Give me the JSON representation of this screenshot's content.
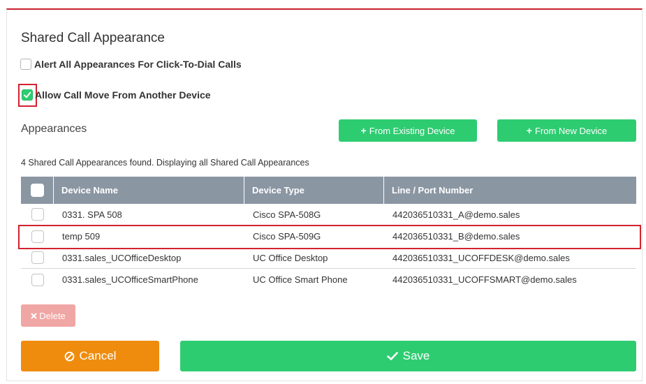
{
  "dialog": {
    "title": "Shared Call Appearance"
  },
  "options": {
    "alert_all": {
      "label": "Alert All Appearances For Click-To-Dial Calls",
      "checked": false
    },
    "allow_move": {
      "label": "Allow Call Move From Another Device",
      "checked": true
    }
  },
  "appearances": {
    "label": "Appearances",
    "add_existing_label": "From Existing Device",
    "add_new_label": "From New Device",
    "found_text": "4 Shared Call Appearances found. Displaying all Shared Call Appearances",
    "columns": [
      "Device Name",
      "Device Type",
      "Line / Port Number"
    ],
    "rows": [
      {
        "name": "0331. SPA 508",
        "type": "Cisco SPA-508G",
        "line": "442036510331_A@demo.sales"
      },
      {
        "name": "temp 509",
        "type": "Cisco SPA-509G",
        "line": "442036510331_B@demo.sales"
      },
      {
        "name": "0331.sales_UCOfficeDesktop",
        "type": "UC Office Desktop",
        "line": "442036510331_UCOFFDESK@demo.sales"
      },
      {
        "name": "0331.sales_UCOfficeSmartPhone",
        "type": "UC Office Smart Phone",
        "line": "442036510331_UCOFFSMART@demo.sales"
      }
    ]
  },
  "actions": {
    "delete_label": "Delete",
    "cancel_label": "Cancel",
    "save_label": "Save"
  },
  "colors": {
    "green": "#2ecc71",
    "orange": "#ef8c0e",
    "delete_pink": "#f0a6a4",
    "header_gray": "#8b96a3",
    "highlight_red": "#d3212f"
  }
}
